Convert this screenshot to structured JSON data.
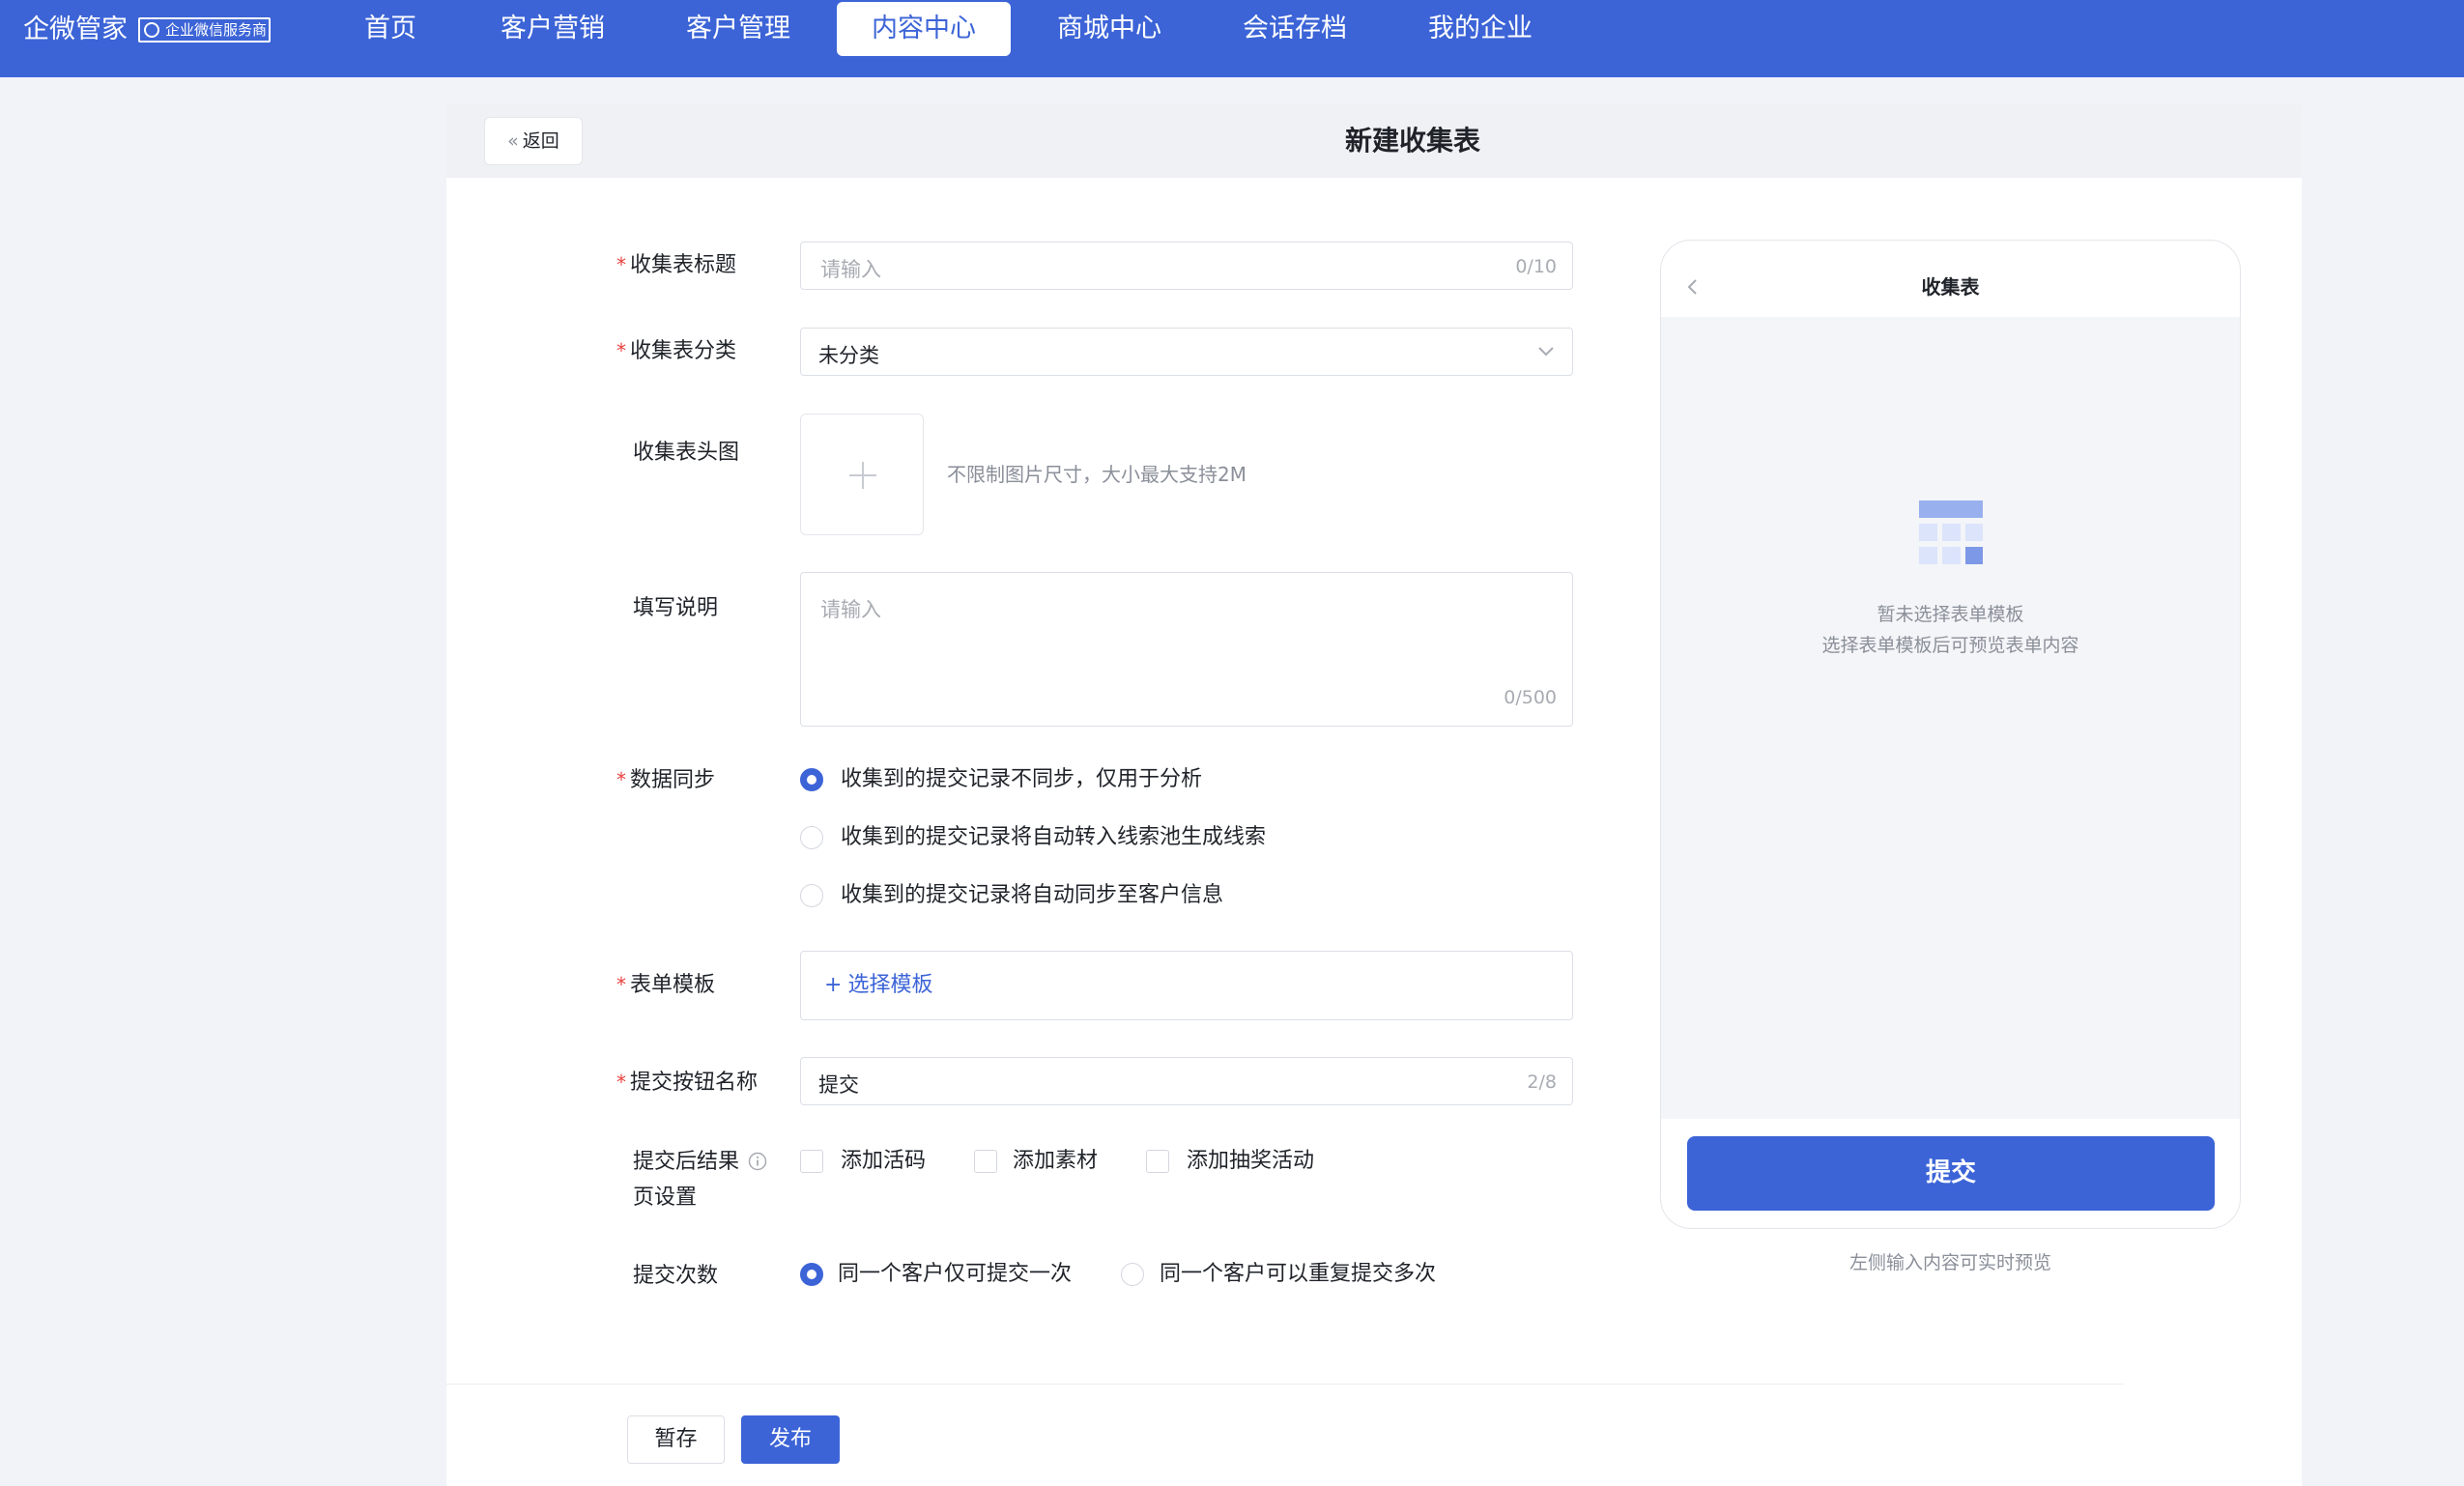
{
  "nav": {
    "brand": "企微管家",
    "badge": "企业微信服务商",
    "items": [
      {
        "label": "首页",
        "active": false
      },
      {
        "label": "客户营销",
        "active": false
      },
      {
        "label": "客户管理",
        "active": false
      },
      {
        "label": "内容中心",
        "active": true
      },
      {
        "label": "商城中心",
        "active": false
      },
      {
        "label": "会话存档",
        "active": false
      },
      {
        "label": "我的企业",
        "active": false
      }
    ]
  },
  "header": {
    "back_label": "返回",
    "title": "新建收集表"
  },
  "form": {
    "title_field": {
      "label": "收集表标题",
      "placeholder": "请输入",
      "count": "0/10"
    },
    "category_field": {
      "label": "收集表分类",
      "value": "未分类"
    },
    "cover_field": {
      "label": "收集表头图",
      "hint": "不限制图片尺寸，大小最大支持2M"
    },
    "desc_field": {
      "label": "填写说明",
      "placeholder": "请输入",
      "count": "0/500"
    },
    "sync_field": {
      "label": "数据同步",
      "options": [
        {
          "label": "收集到的提交记录不同步，仅用于分析",
          "checked": true
        },
        {
          "label": "收集到的提交记录将自动转入线索池生成线索",
          "checked": false
        },
        {
          "label": "收集到的提交记录将自动同步至客户信息",
          "checked": false
        }
      ]
    },
    "template_field": {
      "label": "表单模板",
      "button": "选择模板"
    },
    "submit_name_field": {
      "label": "提交按钮名称",
      "value": "提交",
      "count": "2/8"
    },
    "result_field": {
      "label_line1": "提交后结果",
      "label_line2": "页设置",
      "options": [
        {
          "label": "添加活码",
          "checked": false
        },
        {
          "label": "添加素材",
          "checked": false
        },
        {
          "label": "添加抽奖活动",
          "checked": false
        }
      ]
    },
    "times_field": {
      "label": "提交次数",
      "options": [
        {
          "label": "同一个客户仅可提交一次",
          "checked": true
        },
        {
          "label": "同一个客户可以重复提交多次",
          "checked": false
        }
      ]
    }
  },
  "preview": {
    "title": "收集表",
    "empty_line1": "暂未选择表单模板",
    "empty_line2": "选择表单模板后可预览表单内容",
    "submit_label": "提交",
    "caption": "左侧输入内容可实时预览"
  },
  "footer": {
    "save_label": "暂存",
    "publish_label": "发布"
  },
  "colors": {
    "primary": "#3c64d7",
    "required": "#e8423f"
  }
}
